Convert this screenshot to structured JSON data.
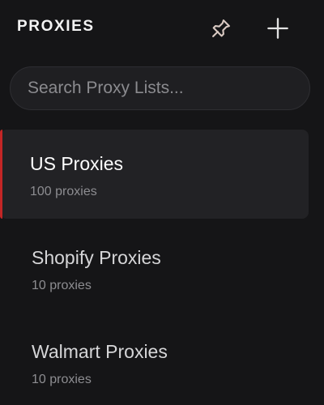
{
  "header": {
    "title": "PROXIES",
    "pin_icon": "pin-icon",
    "add_icon": "plus-icon"
  },
  "search": {
    "placeholder": "Search Proxy Lists..."
  },
  "proxy_lists": [
    {
      "name": "US Proxies",
      "count": "100 proxies",
      "active": true
    },
    {
      "name": "Shopify Proxies",
      "count": "10 proxies",
      "active": false
    },
    {
      "name": "Walmart Proxies",
      "count": "10 proxies",
      "active": false
    }
  ],
  "colors": {
    "background": "#151517",
    "active_item": "#222225",
    "accent": "#c32626"
  }
}
